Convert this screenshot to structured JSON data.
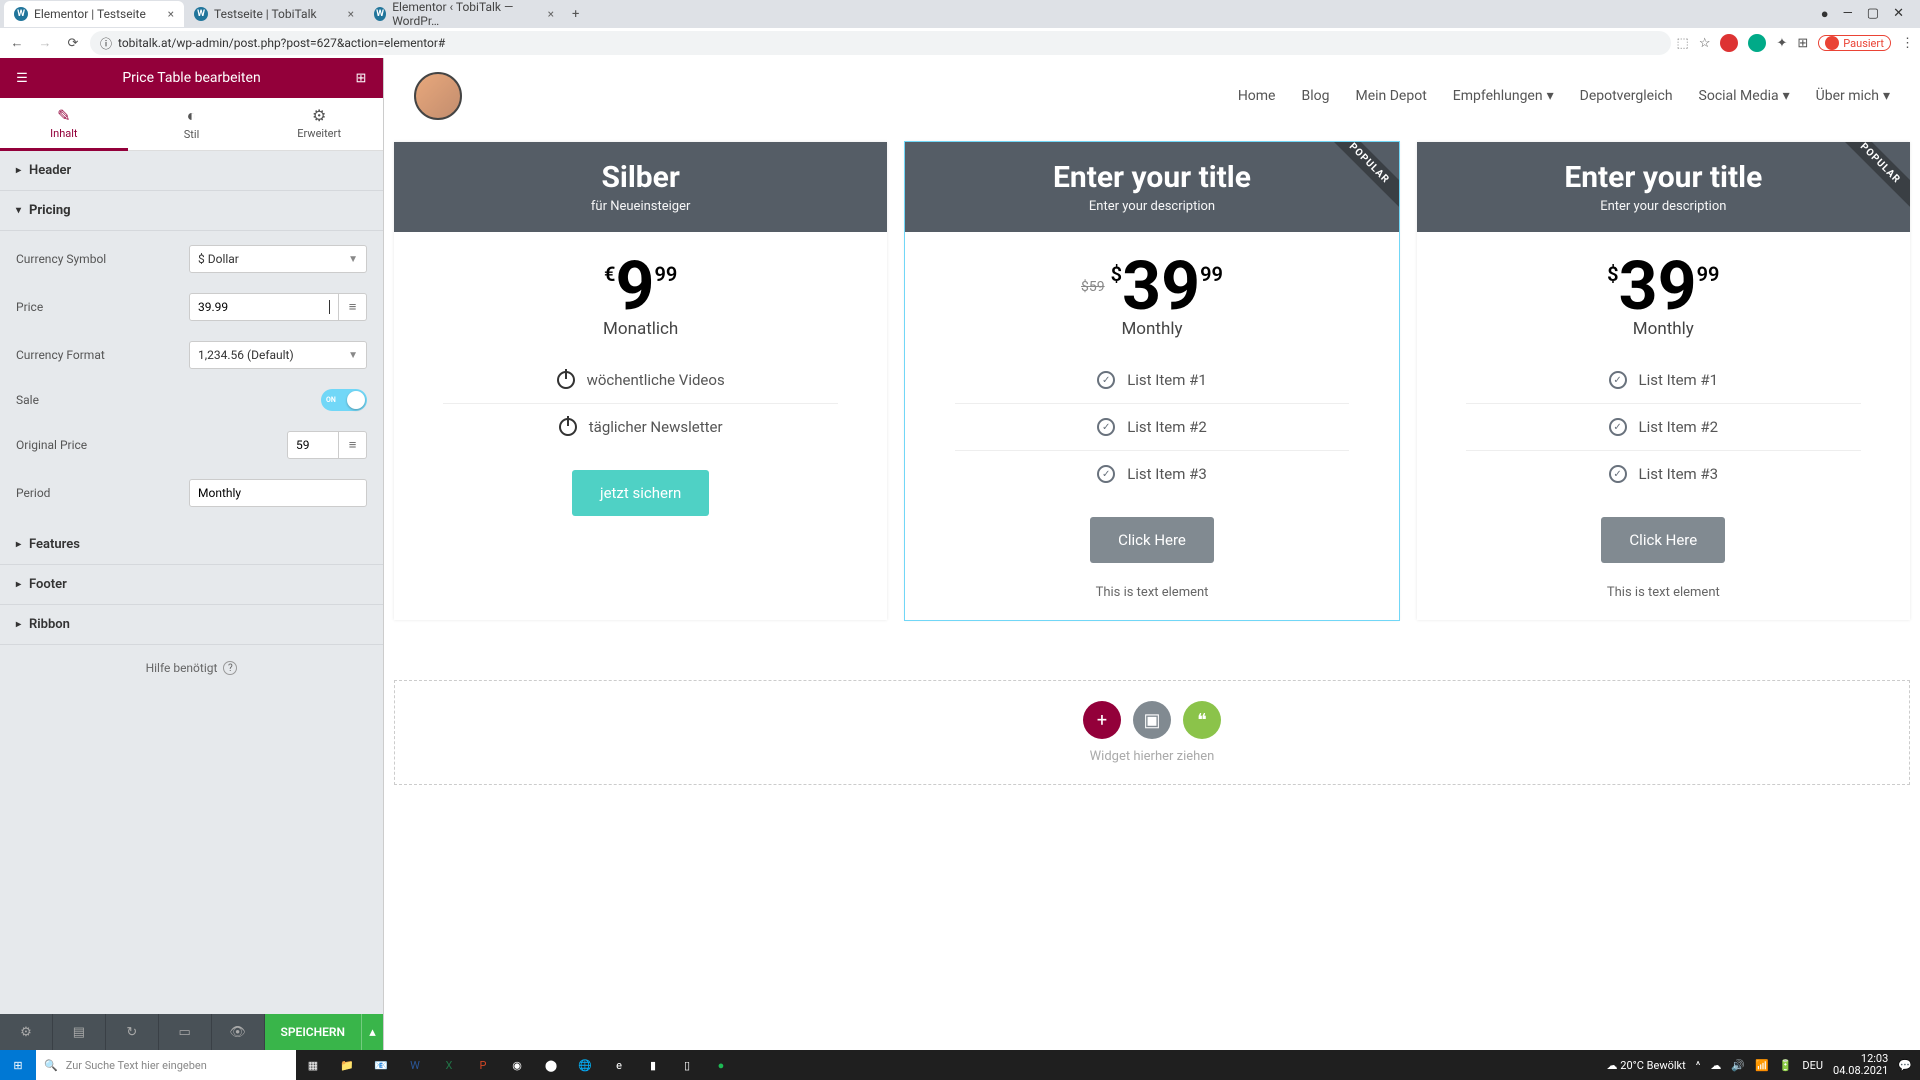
{
  "browser": {
    "tabs": [
      {
        "label": "Elementor | Testseite",
        "active": true
      },
      {
        "label": "Testseite | TobiTalk",
        "active": false
      },
      {
        "label": "Elementor ‹ TobiTalk — WordPr…",
        "active": false
      }
    ],
    "url": "tobitalk.at/wp-admin/post.php?post=627&action=elementor#",
    "paused_label": "Pausiert"
  },
  "sidebar": {
    "title": "Price Table bearbeiten",
    "tabs": {
      "inhalt": "Inhalt",
      "stil": "Stil",
      "erweitert": "Erweitert"
    },
    "sections": {
      "header": "Header",
      "pricing": "Pricing",
      "features": "Features",
      "footer": "Footer",
      "ribbon": "Ribbon"
    },
    "fields": {
      "currency_symbol_label": "Currency Symbol",
      "currency_symbol_value": "$ Dollar",
      "price_label": "Price",
      "price_value": "39.99",
      "currency_format_label": "Currency Format",
      "currency_format_value": "1,234.56 (Default)",
      "sale_label": "Sale",
      "original_price_label": "Original Price",
      "original_price_value": "59",
      "period_label": "Period",
      "period_value": "Monthly"
    },
    "help": "Hilfe benötigt",
    "save": "SPEICHERN"
  },
  "site_nav": [
    "Home",
    "Blog",
    "Mein Depot",
    "Empfehlungen",
    "Depotvergleich",
    "Social Media",
    "Über mich"
  ],
  "tables": [
    {
      "title": "Silber",
      "subtitle": "für Neueinsteiger",
      "ribbon": "",
      "currency": "€",
      "price_int": "9",
      "price_frac": "99",
      "orig": "",
      "period": "Monatlich",
      "features": [
        {
          "icon": "power",
          "text": "wöchentliche Videos"
        },
        {
          "icon": "power",
          "text": "täglicher Newsletter"
        }
      ],
      "cta": "jetzt sichern",
      "cta_style": "teal",
      "footer_text": ""
    },
    {
      "title": "Enter your title",
      "subtitle": "Enter your description",
      "ribbon": "POPULAR",
      "currency": "$",
      "price_int": "39",
      "price_frac": "99",
      "orig": "$59",
      "period": "Monthly",
      "features": [
        {
          "icon": "check",
          "text": "List Item #1"
        },
        {
          "icon": "check",
          "text": "List Item #2"
        },
        {
          "icon": "check",
          "text": "List Item #3"
        }
      ],
      "cta": "Click Here",
      "cta_style": "gray",
      "footer_text": "This is text element"
    },
    {
      "title": "Enter your title",
      "subtitle": "Enter your description",
      "ribbon": "POPULAR",
      "currency": "$",
      "price_int": "39",
      "price_frac": "99",
      "orig": "",
      "period": "Monthly",
      "features": [
        {
          "icon": "check",
          "text": "List Item #1"
        },
        {
          "icon": "check",
          "text": "List Item #2"
        },
        {
          "icon": "check",
          "text": "List Item #3"
        }
      ],
      "cta": "Click Here",
      "cta_style": "gray",
      "footer_text": "This is text element"
    }
  ],
  "widget_drop_text": "Widget hierher ziehen",
  "taskbar": {
    "search_placeholder": "Zur Suche Text hier eingeben",
    "weather": "20°C  Bewölkt",
    "lang": "DEU",
    "time": "12:03",
    "date": "04.08.2021"
  }
}
